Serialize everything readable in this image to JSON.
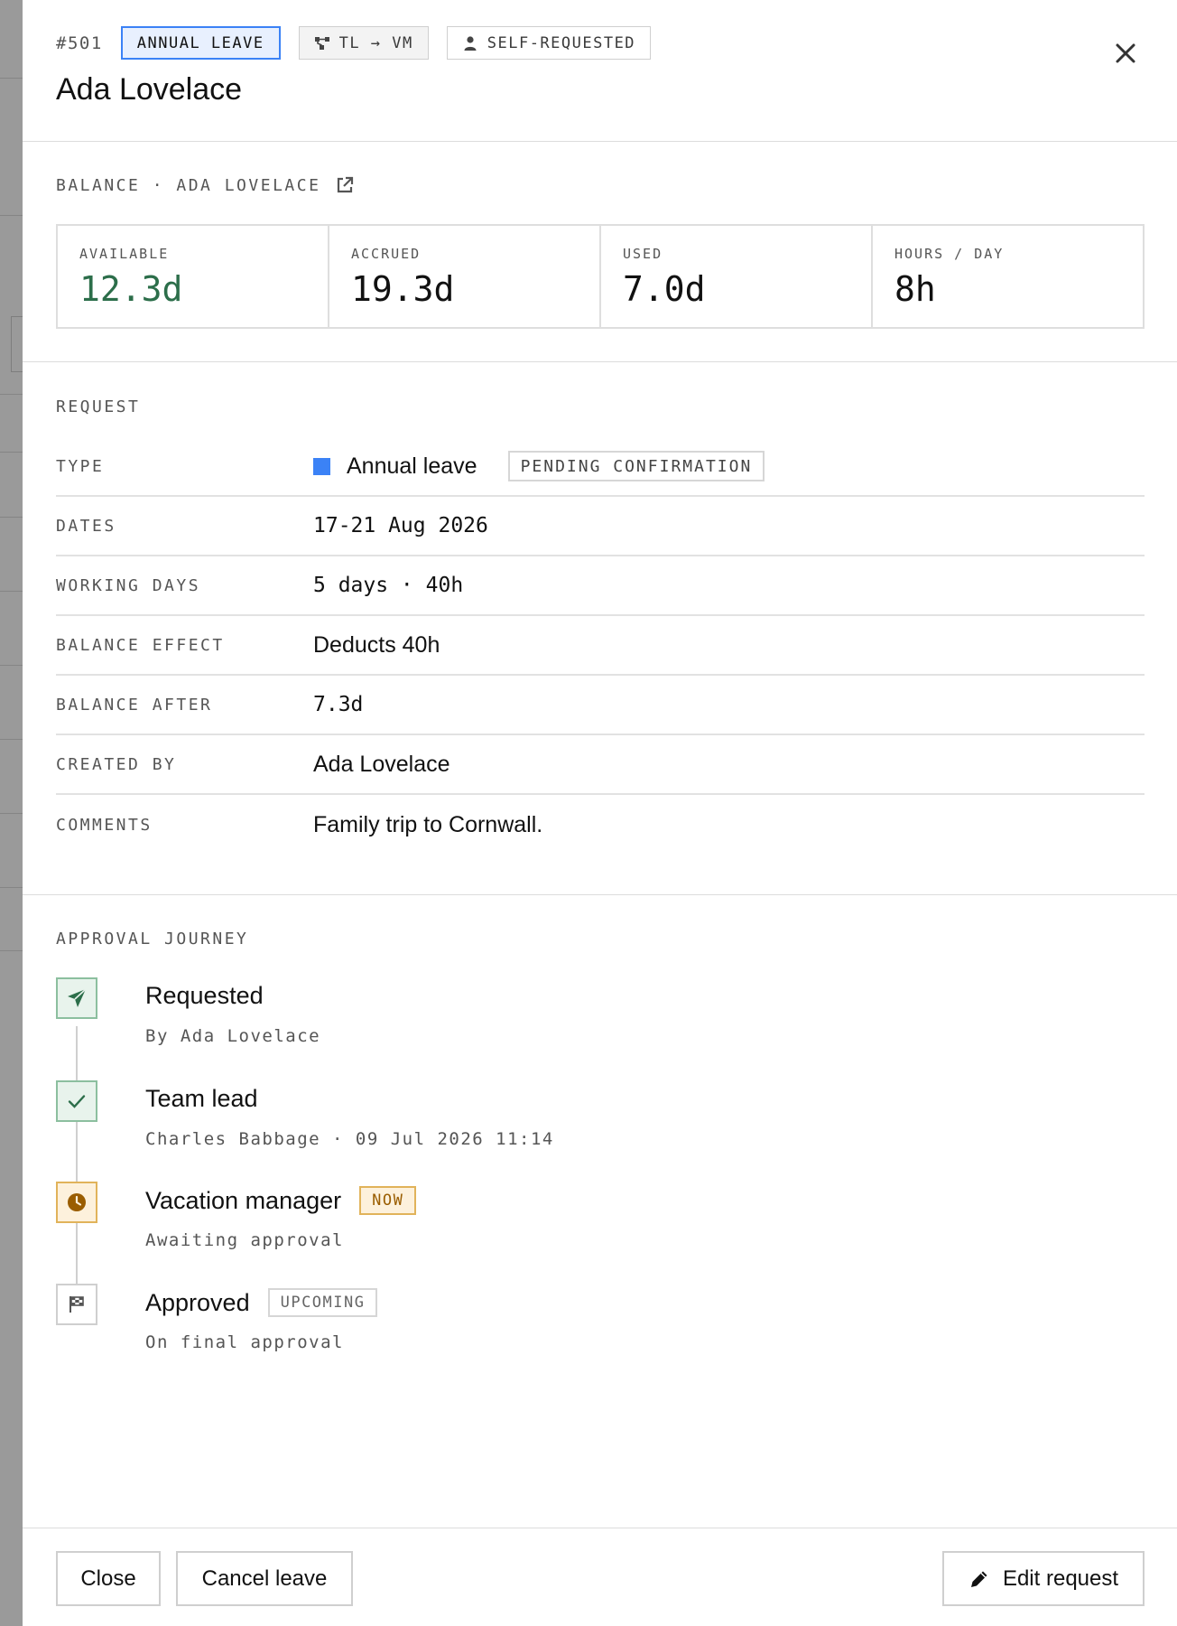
{
  "header": {
    "request_id": "#501",
    "type_chip": "ANNUAL LEAVE",
    "flow_chip": "TL → VM",
    "origin_chip": "SELF-REQUESTED",
    "employee_name": "Ada Lovelace"
  },
  "balance": {
    "heading": "BALANCE · ADA LOVELACE",
    "stats": [
      {
        "label": "AVAILABLE",
        "value": "12.3d"
      },
      {
        "label": "ACCRUED",
        "value": "19.3d"
      },
      {
        "label": "USED",
        "value": "7.0d"
      },
      {
        "label": "HOURS / DAY",
        "value": "8h"
      }
    ]
  },
  "request": {
    "heading": "REQUEST",
    "type_label": "TYPE",
    "type_value": "Annual leave",
    "type_color": "#3b82f6",
    "status": "PENDING CONFIRMATION",
    "dates_label": "DATES",
    "dates_value": "17-21 Aug 2026",
    "working_days_label": "WORKING DAYS",
    "working_days_value": "5 days · 40h",
    "balance_effect_label": "BALANCE EFFECT",
    "balance_effect_value": "Deducts 40h",
    "balance_after_label": "BALANCE AFTER",
    "balance_after_value": "7.3d",
    "created_by_label": "CREATED BY",
    "created_by_value": "Ada Lovelace",
    "comments_label": "COMMENTS",
    "comments_value": "Family trip to Cornwall."
  },
  "journey": {
    "heading": "APPROVAL JOURNEY",
    "steps": [
      {
        "title": "Requested",
        "subtitle": "By Ada Lovelace",
        "icon": "send-icon"
      },
      {
        "title": "Team lead",
        "subtitle": "Charles Babbage · 09 Jul 2026 11:14",
        "icon": "check-icon"
      },
      {
        "title": "Vacation manager",
        "badge": "NOW",
        "subtitle": "Awaiting approval",
        "icon": "clock-icon"
      },
      {
        "title": "Approved",
        "badge": "UPCOMING",
        "subtitle": "On final approval",
        "icon": "flag-icon"
      }
    ]
  },
  "footer": {
    "close_label": "Close",
    "cancel_label": "Cancel leave",
    "edit_label": "Edit request"
  },
  "colors": {
    "accent_blue": "#3b82f6",
    "success_green": "#2c6e4a",
    "pending_amber": "#9a5d00"
  }
}
